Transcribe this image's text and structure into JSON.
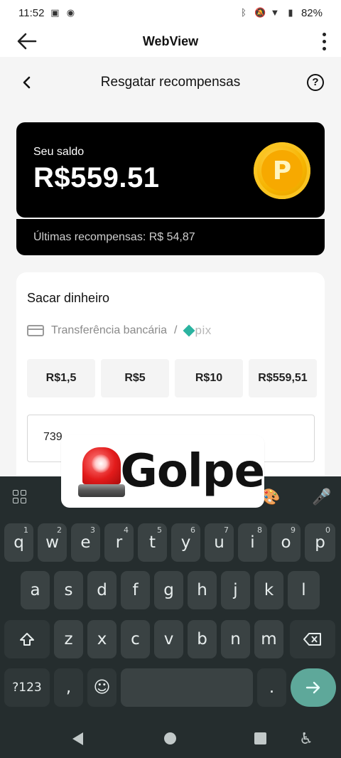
{
  "status_bar": {
    "time": "11:52",
    "battery": "82%"
  },
  "app_bar": {
    "title": "WebView"
  },
  "page": {
    "title": "Resgatar recompensas",
    "help_glyph": "?"
  },
  "balance_card": {
    "label": "Seu saldo",
    "amount": "R$559.51",
    "coin_letter": "P",
    "recent_label": "Últimas recompensas: R$ 54,87"
  },
  "withdraw": {
    "heading": "Sacar dinheiro",
    "method_label": "Transferência bancária",
    "separator": "/",
    "pix_label": "pix",
    "amount_options": [
      "R$1,5",
      "R$5",
      "R$10",
      "R$559,51"
    ],
    "input_value": "739"
  },
  "overlay": {
    "text": "Golpe"
  },
  "keyboard": {
    "row1": [
      {
        "k": "q",
        "n": "1"
      },
      {
        "k": "w",
        "n": "2"
      },
      {
        "k": "e",
        "n": "3"
      },
      {
        "k": "r",
        "n": "4"
      },
      {
        "k": "t",
        "n": "5"
      },
      {
        "k": "y",
        "n": "6"
      },
      {
        "k": "u",
        "n": "7"
      },
      {
        "k": "i",
        "n": "8"
      },
      {
        "k": "o",
        "n": "9"
      },
      {
        "k": "p",
        "n": "0"
      }
    ],
    "row2": [
      "a",
      "s",
      "d",
      "f",
      "g",
      "h",
      "j",
      "k",
      "l"
    ],
    "row3": [
      "z",
      "x",
      "c",
      "v",
      "b",
      "n",
      "m"
    ],
    "symbols_label": "?123",
    "comma": ",",
    "period": "."
  },
  "colors": {
    "accent_enter": "#5ea89a",
    "keyboard_bg": "#252d2e",
    "key_bg": "#3a4243",
    "balance_bg": "#000000",
    "coin": "#f6b400",
    "pix": "#2bb3a0"
  }
}
